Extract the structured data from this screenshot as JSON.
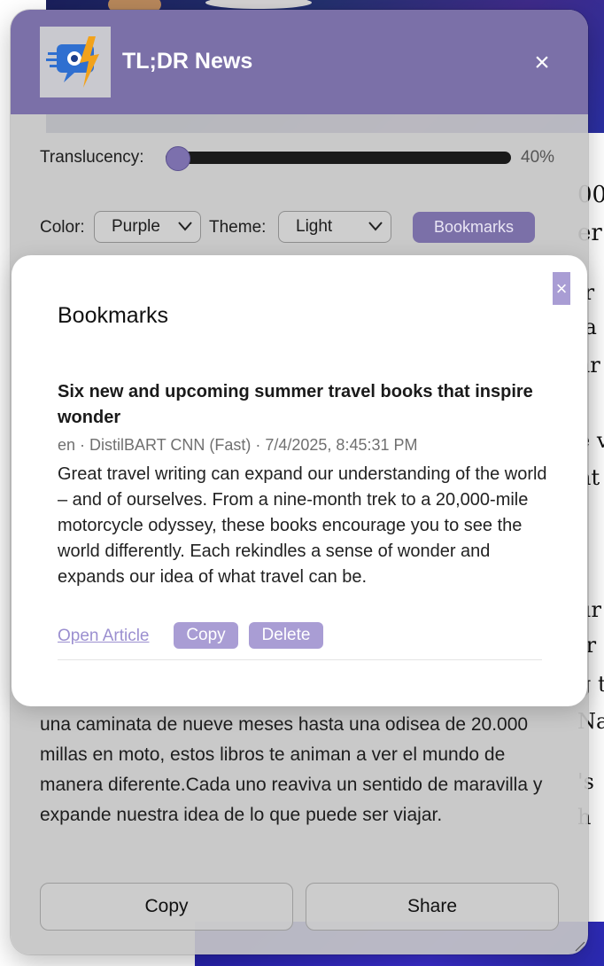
{
  "background_page": {
    "edge_text_lines": [
      "00",
      "er",
      "ir",
      "la",
      "ar",
      "e v",
      "nt",
      "ur",
      "tr",
      "g t",
      "Na",
      "'s",
      "h"
    ]
  },
  "extension": {
    "app_title": "TL;DR News",
    "close_symbol": "×",
    "translucency_label": "Translucency:",
    "translucency_value": "40%",
    "translucency_level": 0.02,
    "color_label": "Color:",
    "color_selected": "Purple",
    "theme_label": "Theme:",
    "theme_selected": "Light",
    "bookmarks_button": "Bookmarks",
    "summary_text": "una caminata de nueve meses hasta una odisea de 20.000 millas en moto, estos libros te animan a ver el mundo de manera diferente.Cada uno reaviva un sentido de maravilla y expande nuestra idea de lo que puede ser viajar.",
    "copy_button": "Copy",
    "share_button": "Share"
  },
  "modal": {
    "close_symbol": "×",
    "title": "Bookmarks",
    "bookmarks": [
      {
        "title": "Six new and upcoming summer travel books that inspire wonder",
        "meta": "en · DistilBART CNN (Fast) · 7/4/2025, 8:45:31 PM",
        "summary": "Great travel writing can expand our understanding of the world – and of ourselves. From a nine-month trek to a 20,000-mile motorcycle odyssey, these books encourage you to see the world differently. Each rekindles a sense of wonder and expands our idea of what travel can be.",
        "open_label": "Open Article",
        "copy_label": "Copy",
        "delete_label": "Delete"
      }
    ]
  },
  "colors": {
    "accent": "#7b70a8",
    "accent_light": "#a99dd4",
    "link": "#9b8fd0"
  },
  "icons": {
    "logo": "tldr-news-logo-icon",
    "chevron": "chevron-down-icon",
    "close": "close-icon"
  }
}
